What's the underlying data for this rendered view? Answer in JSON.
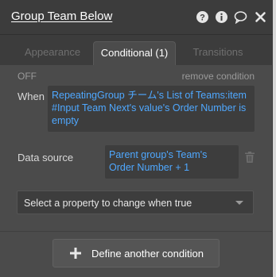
{
  "header": {
    "title": "Group Team Below"
  },
  "tabs": [
    {
      "label": "Appearance",
      "active": false
    },
    {
      "label": "Conditional (1)",
      "active": true
    },
    {
      "label": "Transitions",
      "active": false
    }
  ],
  "condition": {
    "status": "OFF",
    "remove_label": "remove condition",
    "when_label": "When",
    "when_expression": "RepeatingGroup チーム's List of Teams:item #Input Team Next's value's Order Number is empty",
    "datasource_label": "Data source",
    "datasource_expression": "Parent group's Team's Order Number + 1"
  },
  "property_select": {
    "selected": "Select a property to change when true"
  },
  "define_button": {
    "label": "Define another condition"
  },
  "colors": {
    "panel_bg": "#4b4b4b",
    "header_bg": "#3c3c3c",
    "expression_text": "#4fa8ff"
  },
  "icons": {
    "help": "help-icon",
    "info": "info-icon",
    "comment": "comment-icon",
    "close": "close-icon",
    "trash": "trash-icon",
    "plus": "plus-icon"
  }
}
